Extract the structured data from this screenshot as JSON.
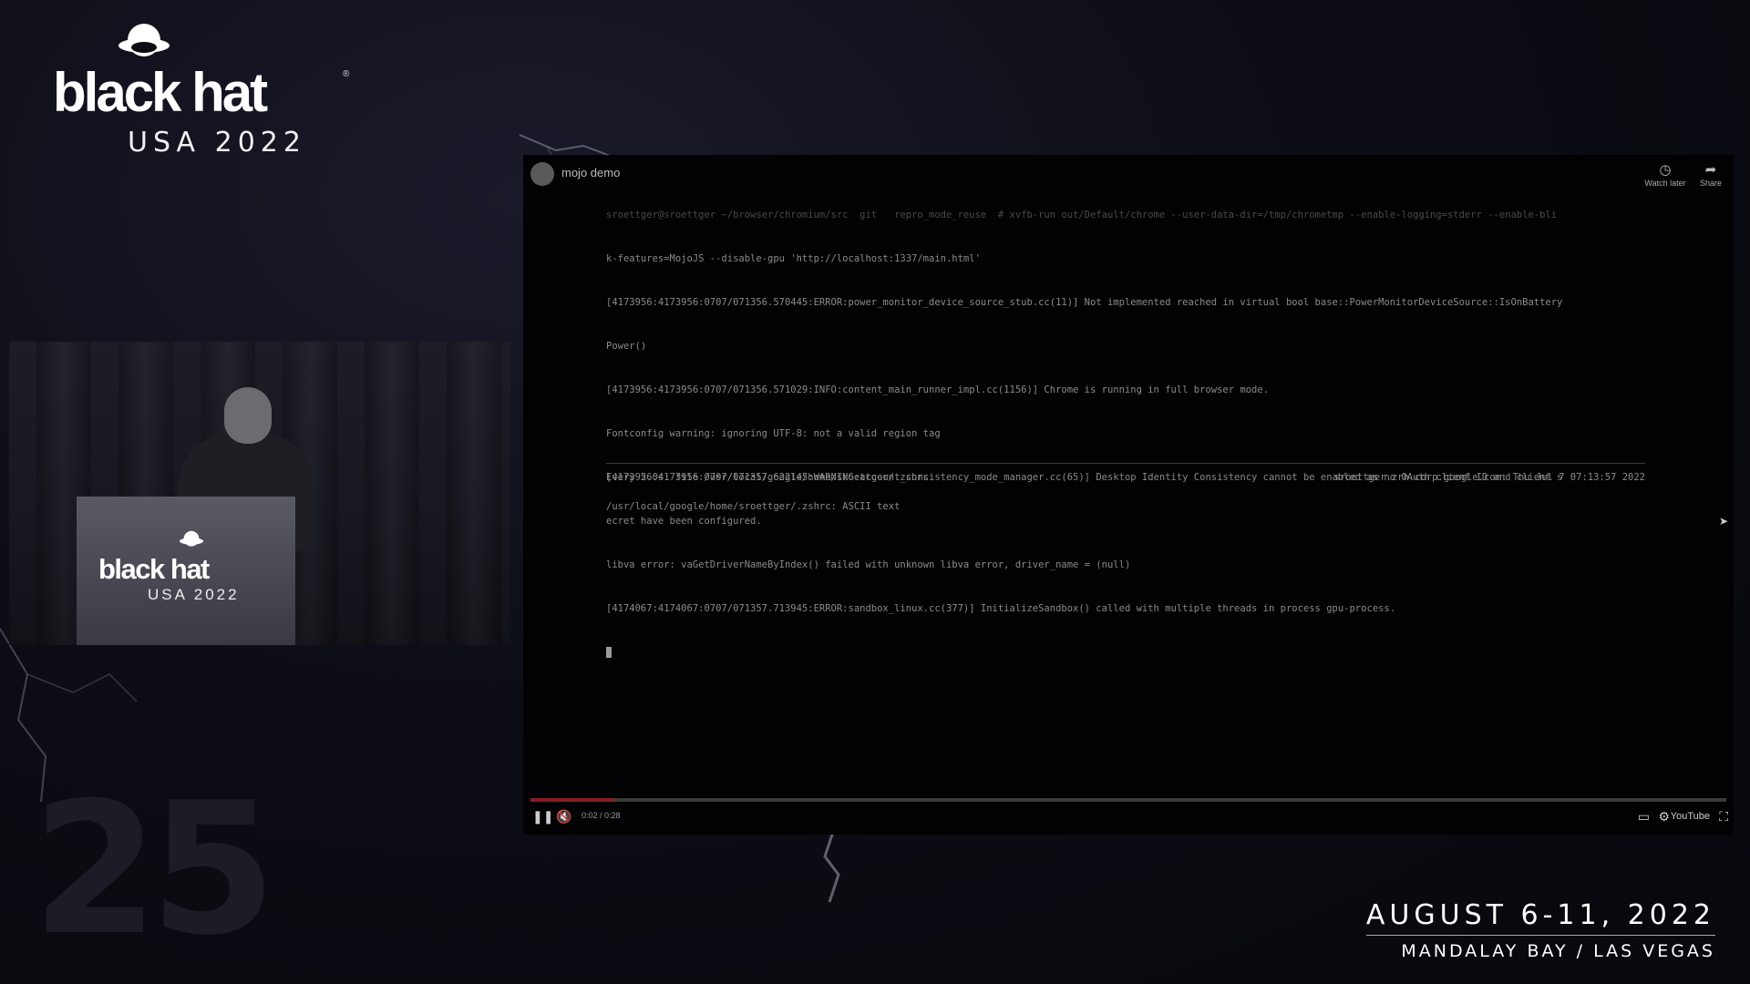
{
  "conference": {
    "brand": "black hat",
    "edition": "USA 2022",
    "dates": "AUGUST 6-11, 2022",
    "venue": "MANDALAY BAY / LAS VEGAS",
    "anniversary": "25",
    "podium_brand": "black hat",
    "podium_edition": "USA 2022"
  },
  "video": {
    "title": "mojo demo",
    "actions": [
      {
        "label": "Watch later",
        "icon": "clock-icon"
      },
      {
        "label": "Share",
        "icon": "share-icon"
      }
    ],
    "terminal_lines": [
      "sroettger@sroettger ~/browser/chromium/src  git   repro_mode_reuse  # xvfb-run out/Default/chrome --user-data-dir=/tmp/chrometmp --enable-logging=stderr --enable-bli",
      "k-features=MojoJS --disable-gpu 'http://localhost:1337/main.html'",
      "[4173956:4173956:0707/071356.570445:ERROR:power_monitor_device_source_stub.cc(11)] Not implemented reached in virtual bool base::PowerMonitorDeviceSource::IsOnBattery",
      "Power()",
      "[4173956:4173956:0707/071356.571029:INFO:content_main_runner_impl.cc(1156)] Chrome is running in full browser mode.",
      "Fontconfig warning: ignoring UTF-8: not a valid region tag",
      "[4173956:4173956:0707/071357.622145:WARNING:account_consistency_mode_manager.cc(65)] Desktop Identity Consistency cannot be enabled as no OAuth client ID and client s",
      "ecret have been configured.",
      "libva error: vaGetDriverNameByIndex() failed with unknown libva error, driver_name = (null)",
      "[4174067:4174067:0707/071357.713945:ERROR:sandbox_linux.cc(377)] InitializeSandbox() called with multiple threads in process gpu-process."
    ],
    "watch_command": "Every 2.0s: file /usr/local/google/home/sroettger/.zshrc",
    "watch_host_time": "sroettger.zrh.corp.google.com: Thu Jul  7 07:13:57 2022",
    "file_output": "/usr/local/google/home/sroettger/.zshrc: ASCII text",
    "time_display": "0:02 / 0:28",
    "progress": 0.07,
    "youtube_label": "YouTube",
    "colors": {
      "progress": "#8a1d1d",
      "background": "#07070c"
    }
  }
}
